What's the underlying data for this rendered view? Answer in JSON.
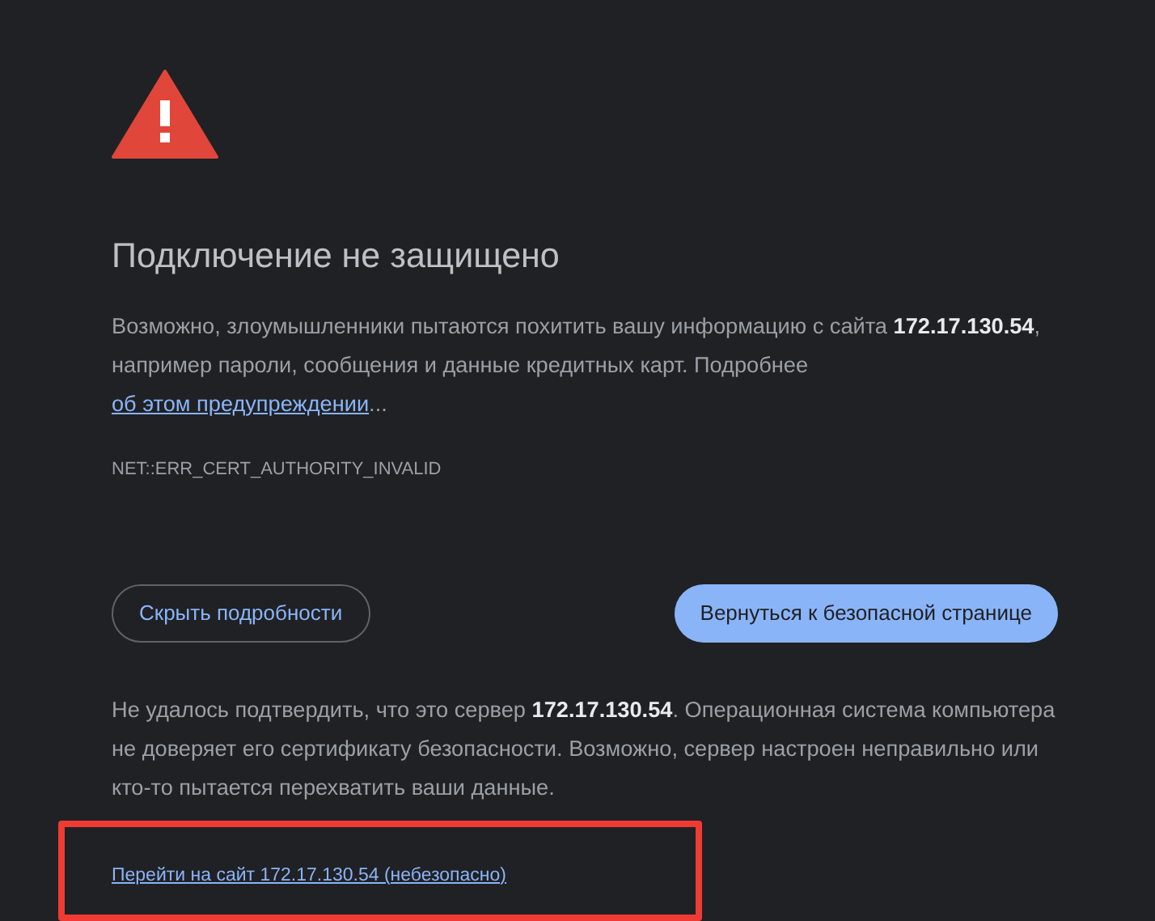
{
  "heading": "Подключение не защищено",
  "intro": {
    "before": "Возможно, злоумышленники пытаются похитить вашу информацию с сайта **172.17.130.54**, например пароли, сообщения и данные кредитных карт. Подробнее ",
    "link": "об этом предупреждении",
    "after": "..."
  },
  "error_code": "NET::ERR_CERT_AUTHORITY_INVALID",
  "buttons": [
    {
      "label": "Скрыть подробности",
      "kind": "outline"
    },
    {
      "label": "Вернуться к безопасной странице",
      "kind": "primary"
    }
  ],
  "details": "Не удалось подтвердить, что это сервер **172.17.130.54**. Операционная система компьютера не доверяет его сертификату безопасности. Возможно, сервер настроен неправильно или кто-то пытается перехватить ваши данные.",
  "proceed_link": {
    "label": "Перейти на сайт 172.17.130.54 (небезопасно)",
    "highlighted": true
  }
}
